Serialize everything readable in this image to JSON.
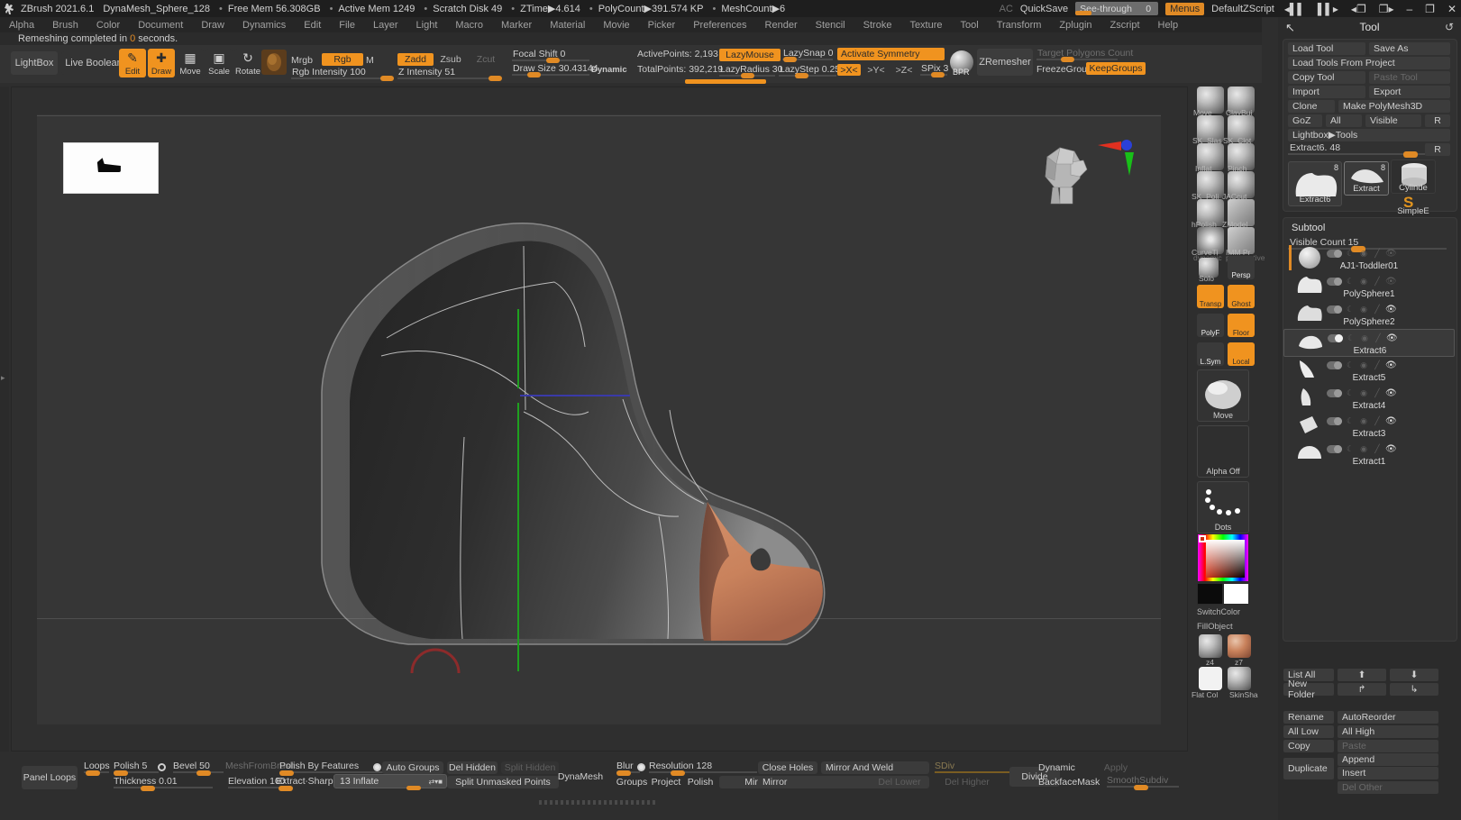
{
  "titlebar": {
    "app": "ZBrush 2021.6.1",
    "document": "DynaMesh_Sphere_128",
    "stats": [
      "Free Mem 56.308GB",
      "Active Mem 1249",
      "Scratch Disk 49",
      "ZTime▶4.614",
      "PolyCount▶391.574 KP",
      "MeshCount▶6"
    ],
    "ac_label": "AC",
    "quicksave": "QuickSave",
    "seethrough_label": "See-through",
    "seethrough_value": "0",
    "menus_button": "Menus",
    "zscript": "DefaultZScript",
    "win_minimize": "–",
    "win_restore": "❐",
    "win_close": "✕"
  },
  "menubar": {
    "items": [
      "Alpha",
      "Brush",
      "Color",
      "Document",
      "Draw",
      "Dynamics",
      "Edit",
      "File",
      "Layer",
      "Light",
      "Macro",
      "Marker",
      "Material",
      "Movie",
      "Picker",
      "Preferences",
      "Render",
      "Stencil",
      "Stroke",
      "Texture",
      "Tool",
      "Transform",
      "Zplugin",
      "Zscript",
      "Help"
    ]
  },
  "statusline": {
    "prefix": "Remeshing completed in",
    "value": "0",
    "suffix": "seconds."
  },
  "topshelf": {
    "lightbox": "LightBox",
    "live_boolean": "Live Boolean",
    "edit": "Edit",
    "draw": "Draw",
    "move": "Move",
    "scale": "Scale",
    "rotate": "Rotate",
    "mrgb": "Mrgb",
    "rgb": "Rgb",
    "m": "M",
    "rgb_intensity": "Rgb Intensity 100",
    "zadd": "Zadd",
    "zsub": "Zsub",
    "zcut": "Zcut",
    "z_intensity": "Z Intensity 51",
    "focal_shift": "Focal Shift 0",
    "draw_size": "Draw Size 30.43144",
    "dynamic": "Dynamic",
    "active_points": "ActivePoints: 2,193",
    "total_points": "TotalPoints: 392,219",
    "lazy_mouse": "LazyMouse",
    "lazy_snap": "LazySnap 0",
    "lazy_radius": "LazyRadius 30",
    "lazy_step": "LazyStep 0.25",
    "activate_symmetry": "Activate Symmetry",
    "sym_x": ">X<",
    "sym_y": ">Y<",
    "sym_z": ">Z<",
    "spix": "SPix 3",
    "bpr": "BPR",
    "zremesher": "ZRemesher",
    "target_polygons_count": "Target Polygons Count",
    "freeze_groups": "FreezeGroups",
    "keep_groups": "KeepGroups"
  },
  "rightshelf": {
    "brushes": [
      {
        "label": "Move"
      },
      {
        "label": "ClayBui"
      },
      {
        "label": "SK_Slas"
      },
      {
        "label": "SK_Clot"
      },
      {
        "label": "Inflat"
      },
      {
        "label": "Pinch"
      },
      {
        "label": "SK_Poli"
      },
      {
        "label": "JACcut_"
      },
      {
        "label": "hPolish"
      },
      {
        "label": "ZModel"
      },
      {
        "label": "CurveTi"
      },
      {
        "label": "IMM Pr"
      }
    ],
    "toggles": [
      {
        "label": "Solo",
        "on": false
      },
      {
        "label": "Persp",
        "on": false
      },
      {
        "label": "Transp",
        "on": true
      },
      {
        "label": "Ghost",
        "on": true
      },
      {
        "label": "PolyF",
        "on": false
      },
      {
        "label": "Floor",
        "on": true
      },
      {
        "label": "L.Sym",
        "on": false
      },
      {
        "label": "Local",
        "on": true
      }
    ],
    "current_brush": "Move",
    "current_alpha": "Alpha Off",
    "current_stroke": "Dots",
    "switch_color": "SwitchColor",
    "fill_object": "FillObject",
    "material_a": "z4",
    "material_b": "z7",
    "material_c": "Flat Col",
    "material_d": "SkinSha"
  },
  "toolpanel": {
    "title": "Tool",
    "back_icon": "↖",
    "refresh_icon": "↺",
    "buttons": {
      "load_tool": "Load Tool",
      "save_as": "Save As",
      "load_tools_from_project": "Load Tools From Project",
      "copy_tool": "Copy Tool",
      "paste_tool": "Paste Tool",
      "import": "Import",
      "export": "Export",
      "clone": "Clone",
      "make_polymesh3d": "Make PolyMesh3D",
      "goz": "GoZ",
      "all": "All",
      "visible": "Visible",
      "r": "R",
      "lightbox_tools": "Lightbox▶Tools"
    },
    "tool_slider": {
      "label": "Extract6. 48",
      "r": "R"
    },
    "tool_thumbs": [
      {
        "caption": "Extract6",
        "badge": "8"
      },
      {
        "caption": "Extract",
        "badge": "8"
      },
      {
        "caption": "Cylinde",
        "badge": ""
      },
      {
        "caption": "SimpleE",
        "badge": ""
      }
    ],
    "subtool": {
      "title": "Subtool",
      "visible_count_label": "Visible Count 15",
      "items": [
        {
          "name": "AJ1-Toddler01",
          "selected": false,
          "eye": false,
          "active": false
        },
        {
          "name": "PolySphere1",
          "selected": false,
          "eye": false,
          "active": false
        },
        {
          "name": "PolySphere2",
          "selected": false,
          "eye": true,
          "active": false
        },
        {
          "name": "Extract6",
          "selected": true,
          "eye": true,
          "active": true
        },
        {
          "name": "Extract5",
          "selected": false,
          "eye": true,
          "active": false
        },
        {
          "name": "Extract4",
          "selected": false,
          "eye": true,
          "active": false
        },
        {
          "name": "Extract3",
          "selected": false,
          "eye": true,
          "active": false
        },
        {
          "name": "Extract1",
          "selected": false,
          "eye": true,
          "active": false
        }
      ],
      "list_all": "List All",
      "new_folder": "New Folder",
      "rename": "Rename",
      "auto_reorder": "AutoReorder",
      "all_low": "All Low",
      "all_high": "All High",
      "copy": "Copy",
      "paste": "Paste",
      "duplicate": "Duplicate",
      "append": "Append",
      "insert": "Insert",
      "del_other": "Del Other",
      "up_icon": "⬆",
      "down_icon": "⬇",
      "out_icon": "↱",
      "in_icon": "↳"
    }
  },
  "bottomshelf": {
    "panel_loops": "Panel Loops",
    "loops": "Loops",
    "polish": "Polish 5",
    "bevel": "Bevel 50",
    "thickness": "Thickness 0.01",
    "elevation": "Elevation 100",
    "mesh_from_brush": "MeshFromBrush",
    "polish_by_features": "Polish By Features",
    "extract_sharp": "Extract∙Sharp",
    "inflate": "13 Inflate",
    "auto_groups": "Auto Groups",
    "del_hidden": "Del Hidden",
    "split_hidden": "Split Hidden",
    "split_unmasked_points": "Split Unmasked Points",
    "dynamesh": "DynaMesh",
    "blur": "Blur",
    "resolution": "Resolution 128",
    "groups": "Groups",
    "project": "Project",
    "polish2": "Polish",
    "mirror": "Mirror",
    "close_holes": "Close Holes",
    "mirror_and_weld": "Mirror And Weld",
    "mirror2": "Mirror",
    "del_lower": "Del Lower",
    "sdiv": "SDiv",
    "del_higher": "Del Higher",
    "divide": "Divide",
    "dynamic": "Dynamic",
    "apply": "Apply",
    "backface_mask": "BackfaceMask",
    "smooth_subdiv": "SmoothSubdiv"
  },
  "colors": {
    "accent": "#f0931f",
    "panel": "#2b2b2b",
    "canvas": "#363636",
    "shelf": "#333333",
    "boot_sole": "#c9825c",
    "boot_body": "#3a3a3a"
  }
}
